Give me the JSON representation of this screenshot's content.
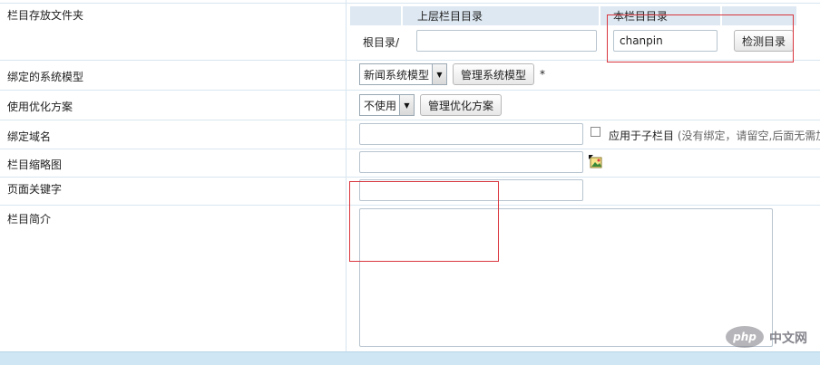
{
  "rows": {
    "folder": {
      "label": "栏目存放文件夹",
      "header_parent": "上层栏目目录",
      "header_current": "本栏目目录",
      "root_label": "根目录/",
      "parent_dir_value": "",
      "current_dir_value": "chanpin",
      "check_button": "检测目录"
    },
    "model": {
      "label": "绑定的系统模型",
      "select_value": "新闻系统模型",
      "manage_button": "管理系统模型",
      "required_mark": "*"
    },
    "seo": {
      "label": "使用优化方案",
      "select_value": "不使用",
      "manage_button": "管理优化方案"
    },
    "domain": {
      "label": "绑定域名",
      "value": "",
      "apply_label": "应用于子栏目",
      "hint": "(没有绑定，请留空,后面无需加"
    },
    "thumb": {
      "label": "栏目缩略图",
      "value": "",
      "icon": "image-picker-icon"
    },
    "keywords": {
      "label": "页面关键字",
      "value": ""
    },
    "intro": {
      "label": "栏目简介",
      "value": ""
    }
  },
  "watermark": {
    "logo_text": "php",
    "site_text": "中文网"
  },
  "colors": {
    "accent_red": "#d9363e",
    "header_bg": "#dde8f2",
    "bottom_bar": "#cfe6f5"
  }
}
